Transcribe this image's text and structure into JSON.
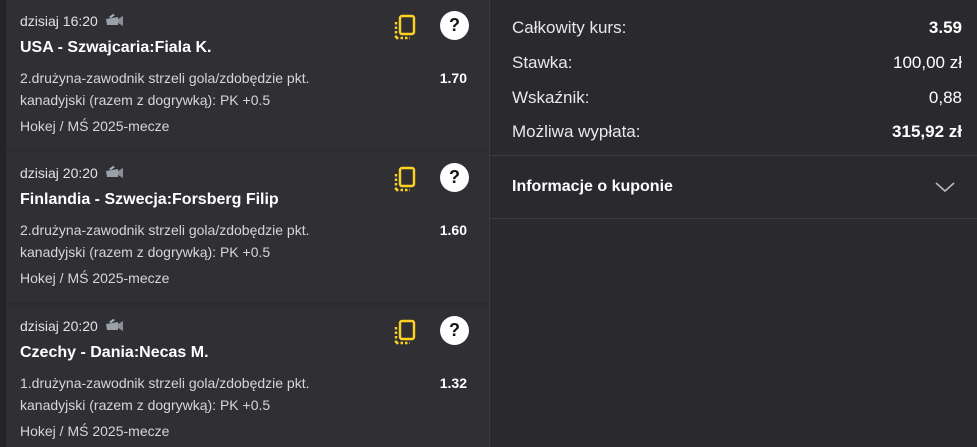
{
  "bets": [
    {
      "time": "dzisiaj 16:20",
      "event": "USA - Szwajcaria:Fiala K.",
      "market_line1": "2.drużyna-zawodnik strzeli gola/zdobędzie pkt.",
      "market_line2": "kanadyjski (razem z dogrywką): PK +0.5",
      "odds": "1.70",
      "league": "Hokej / MŚ 2025-mecze",
      "help": "?"
    },
    {
      "time": "dzisiaj 20:20",
      "event": "Finlandia - Szwecja:Forsberg Filip",
      "market_line1": "2.drużyna-zawodnik strzeli gola/zdobędzie pkt.",
      "market_line2": "kanadyjski (razem z dogrywką): PK +0.5",
      "odds": "1.60",
      "league": "Hokej / MŚ 2025-mecze",
      "help": "?"
    },
    {
      "time": "dzisiaj 20:20",
      "event": "Czechy - Dania:Necas M.",
      "market_line1": "1.drużyna-zawodnik strzeli gola/zdobędzie pkt.",
      "market_line2": "kanadyjski (razem z dogrywką): PK +0.5",
      "odds": "1.32",
      "league": "Hokej / MŚ 2025-mecze",
      "help": "?"
    }
  ],
  "summary": {
    "total_odds_label": "Całkowity kurs:",
    "total_odds_value": "3.59",
    "stake_label": "Stawka:",
    "stake_value": "100,00 zł",
    "ratio_label": "Wskaźnik:",
    "ratio_value": "0,88",
    "payout_label": "Możliwa wypłata:",
    "payout_value": "315,92 zł"
  },
  "coupon_info": {
    "label": "Informacje o kuponie"
  },
  "icons": {
    "live_tv": "tv-stream-icon",
    "copy": "copy-icon",
    "help": "help-icon",
    "expand": "chevron-down-icon"
  },
  "colors": {
    "accent_yellow": "#ffd21f"
  }
}
